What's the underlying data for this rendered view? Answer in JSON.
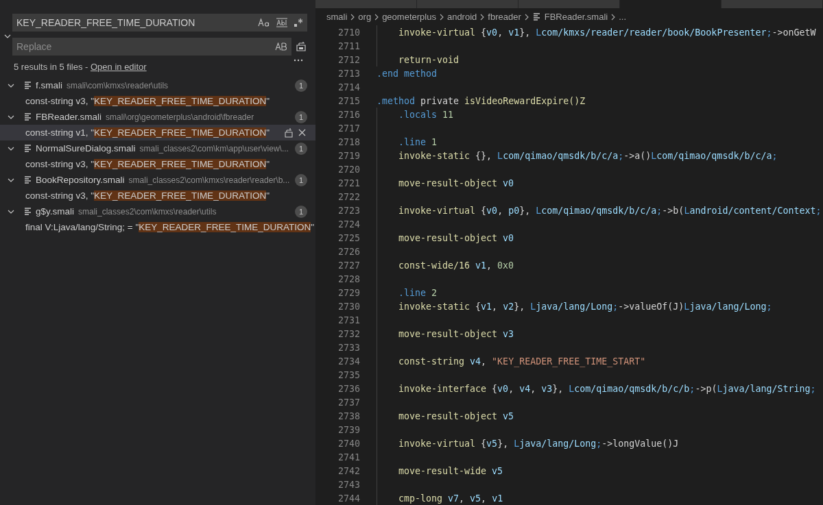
{
  "tabs": [
    {
      "selected": false
    },
    {
      "selected": false
    },
    {
      "selected": false
    },
    {
      "selected": true
    },
    {
      "selected": false
    }
  ],
  "search": {
    "value": "KEY_READER_FREE_TIME_DURATION",
    "replace_placeholder": "Replace",
    "expanded": true
  },
  "summary": {
    "text": "5 results in 5 files - ",
    "link": "Open in editor"
  },
  "results": [
    {
      "name": "f.smali",
      "path": "smali\\com\\kmxs\\reader\\utils",
      "count": "1",
      "expanded": true,
      "matches": [
        {
          "before": "const-string v3, \"",
          "match": "KEY_READER_FREE_TIME_DURATION",
          "after": "\"",
          "selected": false
        }
      ]
    },
    {
      "name": "FBReader.smali",
      "path": "smali\\org\\geometerplus\\android\\fbreader",
      "count": "1",
      "expanded": true,
      "matches": [
        {
          "before": "const-string v1, \"",
          "match": "KEY_READER_FREE_TIME_DURATION",
          "after": "\"",
          "selected": true
        }
      ]
    },
    {
      "name": "NormalSureDialog.smali",
      "path": "smali_classes2\\com\\km\\app\\user\\view\\...",
      "count": "1",
      "expanded": true,
      "matches": [
        {
          "before": "const-string v3, \"",
          "match": "KEY_READER_FREE_TIME_DURATION",
          "after": "\"",
          "selected": false
        }
      ]
    },
    {
      "name": "BookRepository.smali",
      "path": "smali_classes2\\com\\kmxs\\reader\\reader\\b...",
      "count": "1",
      "expanded": true,
      "matches": [
        {
          "before": "const-string v3, \"",
          "match": "KEY_READER_FREE_TIME_DURATION",
          "after": "\"",
          "selected": false
        }
      ]
    },
    {
      "name": "g$y.smali",
      "path": "smali_classes2\\com\\kmxs\\reader\\utils",
      "count": "1",
      "expanded": true,
      "matches": [
        {
          "before": "final V:Ljava/lang/String; = \"",
          "match": "KEY_READER_FREE_TIME_DURATION",
          "after": "\"",
          "selected": false
        }
      ]
    }
  ],
  "breadcrumb": [
    {
      "label": "smali",
      "kind": "folder"
    },
    {
      "label": "org",
      "kind": "folder"
    },
    {
      "label": "geometerplus",
      "kind": "folder"
    },
    {
      "label": "android",
      "kind": "folder"
    },
    {
      "label": "fbreader",
      "kind": "folder"
    },
    {
      "label": "FBReader.smali",
      "kind": "file"
    },
    {
      "label": "...",
      "kind": "more"
    }
  ],
  "code": [
    {
      "children": [
        {
          "number": "2710",
          "tokens": [
            {
              "text": "invoke-virtual ",
              "kind": "op"
            },
            {
              "text": "{",
              "kind": "plain"
            },
            {
              "text": "v0",
              "kind": "reg"
            },
            {
              "text": ", ",
              "kind": "plain"
            },
            {
              "text": "v1",
              "kind": "reg"
            },
            {
              "text": "}, ",
              "kind": "plain"
            },
            {
              "text": "L",
              "kind": "kw"
            },
            {
              "text": "com/kmxs/reader/reader/book/BookPresenter",
              "kind": "reg"
            },
            {
              "text": ";",
              "kind": "kw"
            },
            {
              "text": "->onGetW",
              "kind": "plain"
            }
          ]
        },
        {
          "number": "2711"
        },
        {
          "number": "2712",
          "tokens": [
            {
              "text": "return-void",
              "kind": "op"
            }
          ]
        }
      ]
    },
    {
      "number": "2713",
      "tokens": [
        {
          "text": ".end method",
          "kind": "kw"
        }
      ]
    },
    {
      "number": "2714"
    },
    {
      "number": "2715",
      "tokens": [
        {
          "text": ".method",
          "kind": "kw"
        },
        {
          "text": " private ",
          "kind": "plain"
        },
        {
          "text": "isVideoRewardExpire()Z",
          "kind": "op"
        }
      ],
      "children": [
        {
          "number": "2716",
          "tokens": [
            {
              "text": ".locals",
              "kind": "kw"
            },
            {
              "text": " 11",
              "kind": "num"
            }
          ]
        },
        {
          "number": "2717"
        },
        {
          "number": "2718",
          "tokens": [
            {
              "text": ".line",
              "kind": "kw"
            },
            {
              "text": " 1",
              "kind": "num"
            }
          ]
        },
        {
          "number": "2719",
          "tokens": [
            {
              "text": "invoke-static ",
              "kind": "op"
            },
            {
              "text": "{}, ",
              "kind": "plain"
            },
            {
              "text": "L",
              "kind": "kw"
            },
            {
              "text": "com/qimao/qmsdk/b/c/a",
              "kind": "reg"
            },
            {
              "text": ";",
              "kind": "kw"
            },
            {
              "text": "->a()",
              "kind": "plain"
            },
            {
              "text": "L",
              "kind": "kw"
            },
            {
              "text": "com/qimao/qmsdk/b/c/a",
              "kind": "reg"
            },
            {
              "text": ";",
              "kind": "kw"
            }
          ]
        },
        {
          "number": "2720"
        },
        {
          "number": "2721",
          "tokens": [
            {
              "text": "move-result-object ",
              "kind": "op"
            },
            {
              "text": "v0",
              "kind": "reg"
            }
          ]
        },
        {
          "number": "2722"
        },
        {
          "number": "2723",
          "tokens": [
            {
              "text": "invoke-virtual ",
              "kind": "op"
            },
            {
              "text": "{",
              "kind": "plain"
            },
            {
              "text": "v0",
              "kind": "reg"
            },
            {
              "text": ", ",
              "kind": "plain"
            },
            {
              "text": "p0",
              "kind": "reg"
            },
            {
              "text": "}, ",
              "kind": "plain"
            },
            {
              "text": "L",
              "kind": "kw"
            },
            {
              "text": "com/qimao/qmsdk/b/c/a",
              "kind": "reg"
            },
            {
              "text": ";",
              "kind": "kw"
            },
            {
              "text": "->b(",
              "kind": "plain"
            },
            {
              "text": "L",
              "kind": "kw"
            },
            {
              "text": "android/content/Context",
              "kind": "reg"
            },
            {
              "text": ";",
              "kind": "kw"
            }
          ]
        },
        {
          "number": "2724"
        },
        {
          "number": "2725",
          "tokens": [
            {
              "text": "move-result-object ",
              "kind": "op"
            },
            {
              "text": "v0",
              "kind": "reg"
            }
          ]
        },
        {
          "number": "2726"
        },
        {
          "number": "2727",
          "tokens": [
            {
              "text": "const-wide/16 ",
              "kind": "op"
            },
            {
              "text": "v1",
              "kind": "reg"
            },
            {
              "text": ", ",
              "kind": "plain"
            },
            {
              "text": "0x0",
              "kind": "num"
            }
          ]
        },
        {
          "number": "2728"
        },
        {
          "number": "2729",
          "tokens": [
            {
              "text": ".line",
              "kind": "kw"
            },
            {
              "text": " 2",
              "kind": "num"
            }
          ]
        },
        {
          "number": "2730",
          "tokens": [
            {
              "text": "invoke-static ",
              "kind": "op"
            },
            {
              "text": "{",
              "kind": "plain"
            },
            {
              "text": "v1",
              "kind": "reg"
            },
            {
              "text": ", ",
              "kind": "plain"
            },
            {
              "text": "v2",
              "kind": "reg"
            },
            {
              "text": "}, ",
              "kind": "plain"
            },
            {
              "text": "L",
              "kind": "kw"
            },
            {
              "text": "java/lang/Long",
              "kind": "reg"
            },
            {
              "text": ";",
              "kind": "kw"
            },
            {
              "text": "->valueOf(J)",
              "kind": "plain"
            },
            {
              "text": "L",
              "kind": "kw"
            },
            {
              "text": "java/lang/Long",
              "kind": "reg"
            },
            {
              "text": ";",
              "kind": "kw"
            }
          ]
        },
        {
          "number": "2731"
        },
        {
          "number": "2732",
          "tokens": [
            {
              "text": "move-result-object ",
              "kind": "op"
            },
            {
              "text": "v3",
              "kind": "reg"
            }
          ]
        },
        {
          "number": "2733"
        },
        {
          "number": "2734",
          "tokens": [
            {
              "text": "const-string ",
              "kind": "op"
            },
            {
              "text": "v4",
              "kind": "reg"
            },
            {
              "text": ", ",
              "kind": "plain"
            },
            {
              "text": "\"KEY_READER_FREE_TIME_START\"",
              "kind": "str"
            }
          ]
        },
        {
          "number": "2735"
        },
        {
          "number": "2736",
          "tokens": [
            {
              "text": "invoke-interface ",
              "kind": "op"
            },
            {
              "text": "{",
              "kind": "plain"
            },
            {
              "text": "v0",
              "kind": "reg"
            },
            {
              "text": ", ",
              "kind": "plain"
            },
            {
              "text": "v4",
              "kind": "reg"
            },
            {
              "text": ", ",
              "kind": "plain"
            },
            {
              "text": "v3",
              "kind": "reg"
            },
            {
              "text": "}, ",
              "kind": "plain"
            },
            {
              "text": "L",
              "kind": "kw"
            },
            {
              "text": "com/qimao/qmsdk/b/c/b",
              "kind": "reg"
            },
            {
              "text": ";",
              "kind": "kw"
            },
            {
              "text": "->p(",
              "kind": "plain"
            },
            {
              "text": "L",
              "kind": "kw"
            },
            {
              "text": "java/lang/String",
              "kind": "reg"
            },
            {
              "text": ";",
              "kind": "kw"
            }
          ]
        },
        {
          "number": "2737"
        },
        {
          "number": "2738",
          "tokens": [
            {
              "text": "move-result-object ",
              "kind": "op"
            },
            {
              "text": "v5",
              "kind": "reg"
            }
          ]
        },
        {
          "number": "2739"
        },
        {
          "number": "2740",
          "tokens": [
            {
              "text": "invoke-virtual ",
              "kind": "op"
            },
            {
              "text": "{",
              "kind": "plain"
            },
            {
              "text": "v5",
              "kind": "reg"
            },
            {
              "text": "}, ",
              "kind": "plain"
            },
            {
              "text": "L",
              "kind": "kw"
            },
            {
              "text": "java/lang/Long",
              "kind": "reg"
            },
            {
              "text": ";",
              "kind": "kw"
            },
            {
              "text": "->longValue()J",
              "kind": "plain"
            }
          ]
        },
        {
          "number": "2741"
        },
        {
          "number": "2742",
          "tokens": [
            {
              "text": "move-result-wide ",
              "kind": "op"
            },
            {
              "text": "v5",
              "kind": "reg"
            }
          ]
        },
        {
          "number": "2743"
        },
        {
          "number": "2744",
          "tokens": [
            {
              "text": "cmp-long ",
              "kind": "op"
            },
            {
              "text": "v7",
              "kind": "reg"
            },
            {
              "text": ", ",
              "kind": "plain"
            },
            {
              "text": "v5",
              "kind": "reg"
            },
            {
              "text": ", ",
              "kind": "plain"
            },
            {
              "text": "v1",
              "kind": "reg"
            }
          ]
        }
      ]
    }
  ]
}
